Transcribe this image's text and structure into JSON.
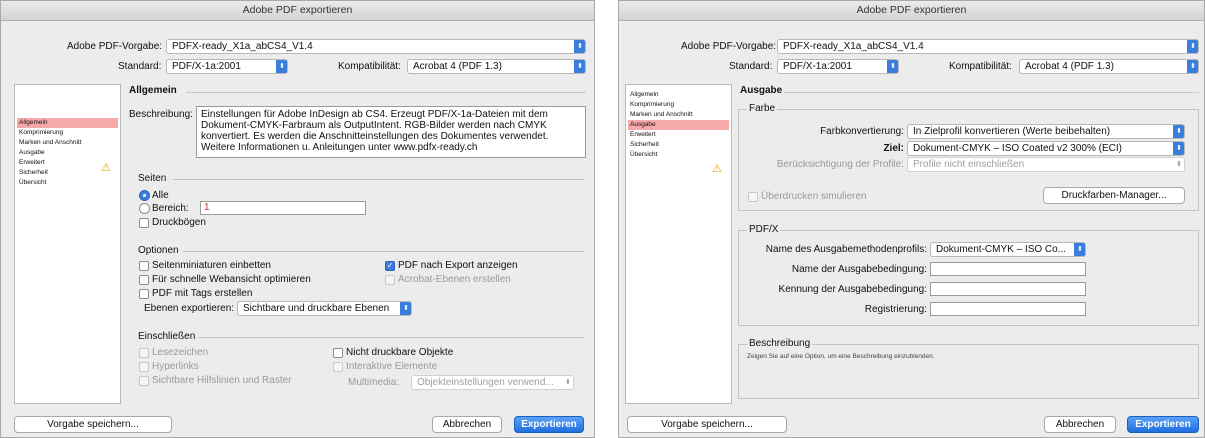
{
  "left": {
    "title": "Adobe PDF exportieren",
    "vorgabe_label": "Adobe PDF-Vorgabe:",
    "vorgabe_value": "PDFX-ready_X1a_abCS4_V1.4",
    "standard_label": "Standard:",
    "standard_value": "PDF/X-1a:2001",
    "kompat_label": "Kompatibilität:",
    "kompat_value": "Acrobat 4 (PDF 1.3)",
    "sidebar": [
      "Allgemein",
      "Komprimierung",
      "Marken und Anschnitt",
      "Ausgabe",
      "Erweitert",
      "Sicherheit",
      "Übersicht"
    ],
    "section_title": "Allgemein",
    "beschreibung_label": "Beschreibung:",
    "beschreibung_text": "Einstellungen für Adobe InDesign ab CS4. Erzeugt PDF/X-1a-Dateien mit dem Dokument-CMYK-Farbraum als OutputIntent. RGB-Bilder werden nach CMYK konvertiert. Es werden die Anschnitteinstellungen des Dokumentes verwendet. Weitere Informationen u. Anleitungen unter www.pdfx-ready.ch",
    "seiten": {
      "title": "Seiten",
      "alle": "Alle",
      "bereich": "Bereich:",
      "bereich_value": "1",
      "druckboegen": "Druckbögen"
    },
    "optionen": {
      "title": "Optionen",
      "miniaturen": "Seitenminiaturen einbetten",
      "webansicht": "Für schnelle Webansicht optimieren",
      "tags": "PDF mit Tags erstellen",
      "ebenen_label": "Ebenen exportieren:",
      "ebenen_value": "Sichtbare und druckbare Ebenen",
      "nach_export": "PDF nach Export anzeigen",
      "acrobat_ebenen": "Acrobat-Ebenen erstellen"
    },
    "einschliessen": {
      "title": "Einschließen",
      "lesezeichen": "Lesezeichen",
      "hyperlinks": "Hyperlinks",
      "hilfslinien": "Sichtbare Hilfslinien und Raster",
      "nicht_druckbar": "Nicht druckbare Objekte",
      "interaktiv": "Interaktive Elemente",
      "multimedia_label": "Multimedia:",
      "multimedia_value": "Objekteinstellungen verwend..."
    },
    "btn_save": "Vorgabe speichern...",
    "btn_cancel": "Abbrechen",
    "btn_export": "Exportieren"
  },
  "right": {
    "title": "Adobe PDF exportieren",
    "vorgabe_label": "Adobe PDF-Vorgabe:",
    "vorgabe_value": "PDFX-ready_X1a_abCS4_V1.4",
    "standard_label": "Standard:",
    "standard_value": "PDF/X-1a:2001",
    "kompat_label": "Kompatibilität:",
    "kompat_value": "Acrobat 4 (PDF 1.3)",
    "sidebar": [
      "Allgemein",
      "Komprimierung",
      "Marken und Anschnitt",
      "Ausgabe",
      "Erweitert",
      "Sicherheit",
      "Übersicht"
    ],
    "section_title": "Ausgabe",
    "farbe": {
      "title": "Farbe",
      "konv_label": "Farbkonvertierung:",
      "konv_value": "In Zielprofil konvertieren (Werte beibehalten)",
      "ziel_label": "Ziel:",
      "ziel_value": "Dokument-CMYK – ISO Coated v2 300% (ECI)",
      "profile_label": "Berücksichtigung der Profile:",
      "profile_value": "Profile nicht einschließen",
      "ueberdrucken": "Überdrucken simulieren",
      "manager": "Druckfarben-Manager..."
    },
    "pdfx": {
      "title": "PDF/X",
      "profil_label": "Name des Ausgabemethodenprofils:",
      "profil_value": "Dokument-CMYK – ISO Co...",
      "bedingung_label": "Name der Ausgabebedingung:",
      "kennung_label": "Kennung der Ausgabebedingung:",
      "registrierung_label": "Registrierung:"
    },
    "beschreibung": {
      "title": "Beschreibung",
      "text": "Zeigen Sie auf eine Option, um eine Beschreibung einzublenden."
    },
    "btn_save": "Vorgabe speichern...",
    "btn_cancel": "Abbrechen",
    "btn_export": "Exportieren"
  }
}
